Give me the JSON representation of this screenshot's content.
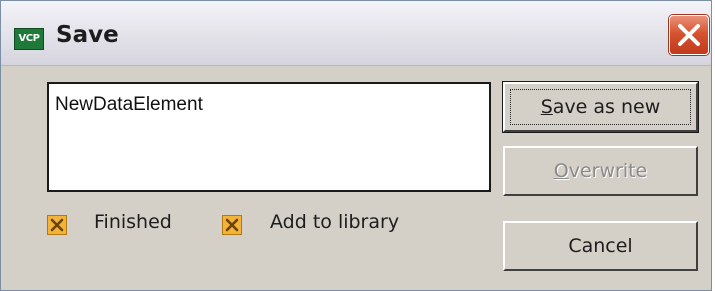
{
  "window": {
    "title": "Save",
    "app_icon_text": "VCP",
    "close_icon": "close-icon",
    "accent": "#1f7a3a",
    "close_color": "#d7542f"
  },
  "name_field": {
    "value": "NewDataElement"
  },
  "options": {
    "finished": {
      "label": "Finished",
      "checked": true
    },
    "add_to_library": {
      "label": "Add to library",
      "checked": true
    },
    "check_color": "#f3b23a"
  },
  "buttons": {
    "save_as_new": {
      "mnemonic": "S",
      "rest": "ave as new",
      "enabled": true
    },
    "overwrite": {
      "mnemonic": "O",
      "rest": "verwrite",
      "enabled": false
    },
    "cancel": {
      "label": "Cancel",
      "enabled": true
    }
  }
}
